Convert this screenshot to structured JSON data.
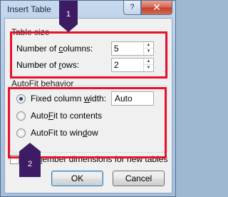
{
  "window": {
    "title": "Insert Table",
    "help_label": "?",
    "close_label": "✕"
  },
  "table_size": {
    "group_label": "Table size",
    "columns": {
      "label_pre": "Number of ",
      "label_accel": "c",
      "label_post": "olumns:",
      "value": "5"
    },
    "rows": {
      "label_pre": "Number of ",
      "label_accel": "r",
      "label_post": "ows:",
      "value": "2"
    }
  },
  "autofit": {
    "group_label": "AutoFit behavior",
    "options": [
      {
        "label_pre": "Fixed column ",
        "label_accel": "w",
        "label_post": "idth:",
        "selected": true
      },
      {
        "label_pre": "Auto",
        "label_accel": "F",
        "label_post": "it to contents",
        "selected": false
      },
      {
        "label_pre": "AutoFit to win",
        "label_accel": "d",
        "label_post": "ow",
        "selected": false
      }
    ],
    "fixed_width_value": "Auto"
  },
  "remember_dimensions": {
    "label_pre": "Re",
    "label_accel": "m",
    "label_post": "ember dimensions for new tables",
    "checked": false
  },
  "buttons": {
    "ok": "OK",
    "cancel": "Cancel"
  },
  "annotations": {
    "highlight_color": "#e8102a",
    "callout_color": "#3d1c63",
    "callouts": [
      "1",
      "2"
    ]
  }
}
